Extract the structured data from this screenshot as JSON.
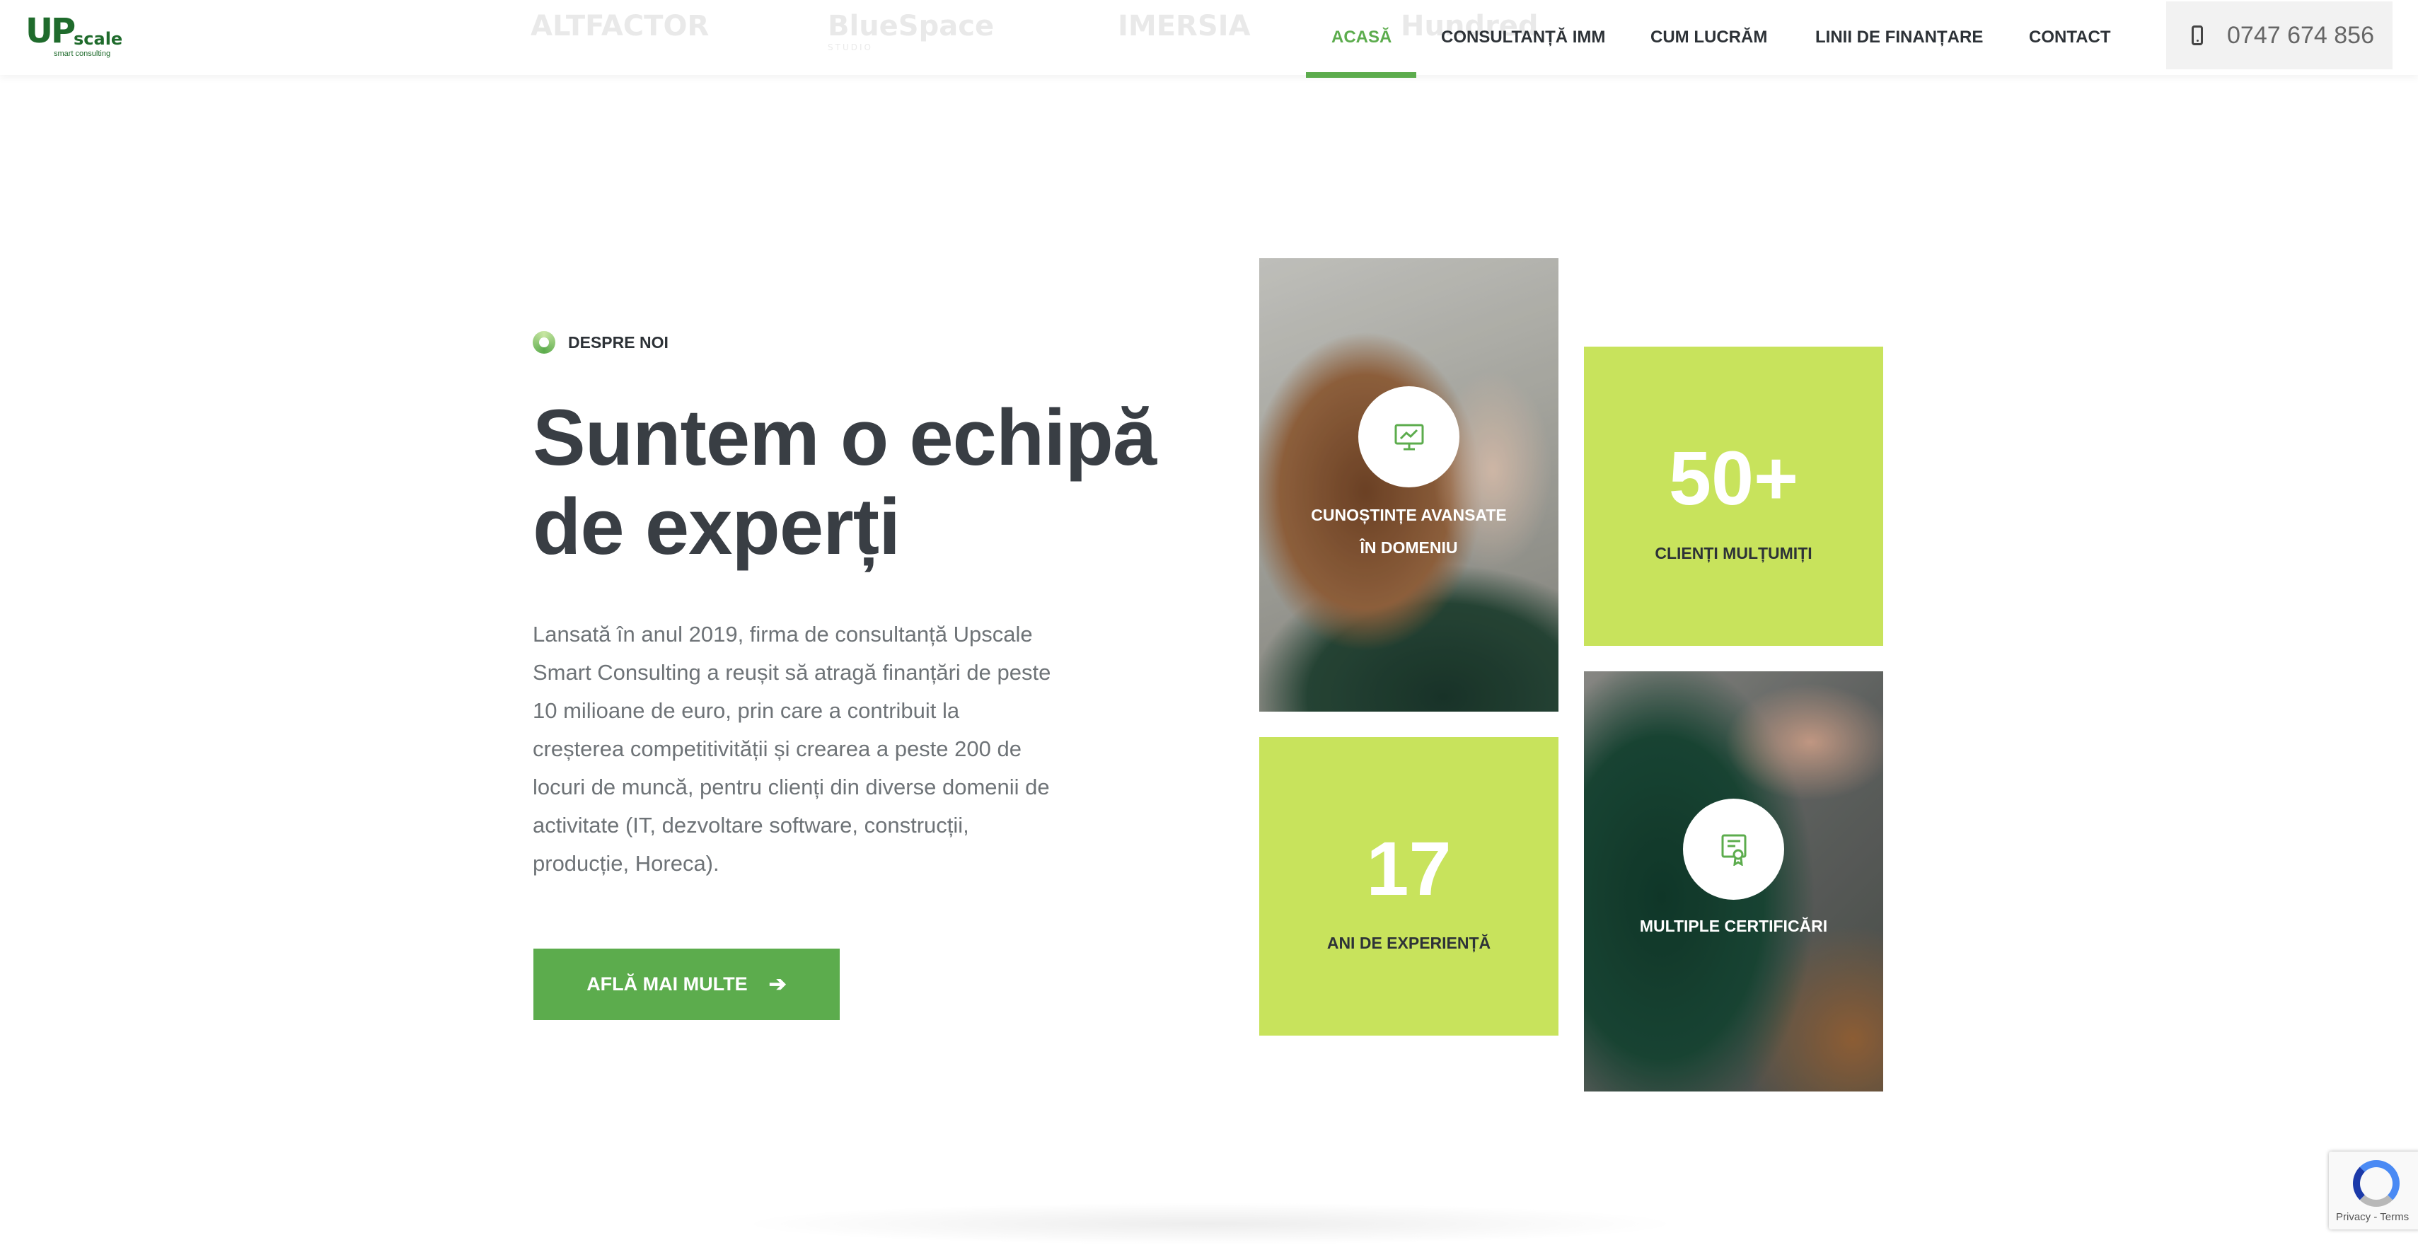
{
  "header": {
    "logo": {
      "brand_main": "UP",
      "brand_sub": "scale",
      "tagline": "smart consulting"
    },
    "partners": [
      {
        "name": "ALTFACTOR",
        "sub": ""
      },
      {
        "name": "BlueSpace",
        "sub": "STUDIO"
      },
      {
        "name": "IMERSIA",
        "sub": ""
      },
      {
        "name": "Hundred",
        "sub": ""
      }
    ],
    "nav": [
      {
        "label": "ACASĂ",
        "active": true
      },
      {
        "label": "CONSULTANȚĂ IMM",
        "active": false
      },
      {
        "label": "CUM LUCRĂM",
        "active": false
      },
      {
        "label": "LINII DE FINANȚARE",
        "active": false
      },
      {
        "label": "CONTACT",
        "active": false
      }
    ],
    "phone": {
      "icon": "phone-icon",
      "number": "0747 674 856"
    }
  },
  "about": {
    "eyebrow": "DESPRE NOI",
    "title_line1": "Suntem o echipă",
    "title_line2": "de experți",
    "description": "Lansată în anul 2019, firma de consultanță Upscale Smart Consulting a reușit să atragă finanțări de peste 10 milioane de euro, prin care a contribuit la creșterea competitivității și crearea a peste 200 de locuri de muncă, pentru clienți din diverse domenii de activitate (IT, dezvoltare software, construcții, producție, Horeca).",
    "cta": {
      "label": "AFLĂ MAI MULTE",
      "icon": "arrow-right-icon"
    }
  },
  "tiles": {
    "knowledge": {
      "icon": "presentation-chart-icon",
      "line1": "CUNOȘTINȚE AVANSATE",
      "line2": "ÎN DOMENIU"
    },
    "clients": {
      "number": "50+",
      "label": "CLIENȚI MULȚUMIȚI"
    },
    "experience": {
      "number": "17",
      "label": "ANI DE EXPERIENȚĂ"
    },
    "certifications": {
      "icon": "certificate-icon",
      "label": "MULTIPLE CERTIFICĂRI"
    }
  },
  "recaptcha": {
    "links": "Privacy - Terms"
  },
  "colors": {
    "accent": "#5cac4d",
    "lime": "#c8e35c",
    "heading": "#393e44",
    "body_text": "#6e7377",
    "logo_green": "#1f6b2c"
  }
}
